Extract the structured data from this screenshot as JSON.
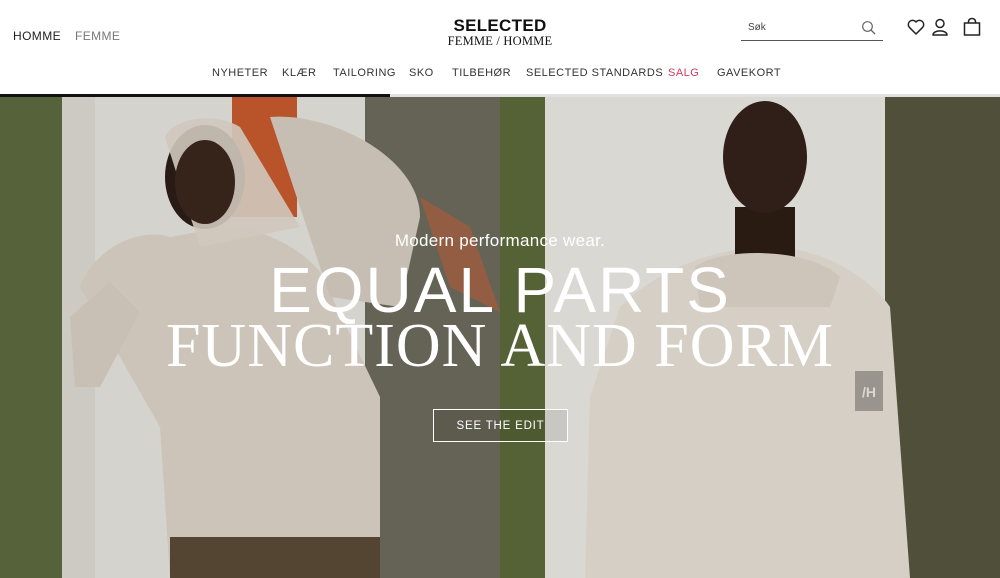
{
  "header": {
    "gender_tabs": [
      "HOMME",
      "FEMME"
    ],
    "logo_line1": "SELECTED",
    "logo_line2": "FEMME / HOMME",
    "search": {
      "placeholder": "Søk"
    },
    "icons": [
      "search-icon",
      "heart-icon",
      "user-icon",
      "shopping-bag-icon"
    ]
  },
  "nav": {
    "items": [
      "NYHETER",
      "KLÆR",
      "TAILORING",
      "SKO",
      "TILBEHØR",
      "SELECTED STANDARDS",
      "SALG",
      "GAVEKORT"
    ],
    "sale_color": "#d33a5e"
  },
  "hero": {
    "tagline": "Modern performance wear.",
    "headline_line1": "EQUAL PARTS",
    "headline_line2": "FUNCTION AND FORM",
    "cta_label": "SEE THE EDIT",
    "slider_progress": 0.39
  }
}
